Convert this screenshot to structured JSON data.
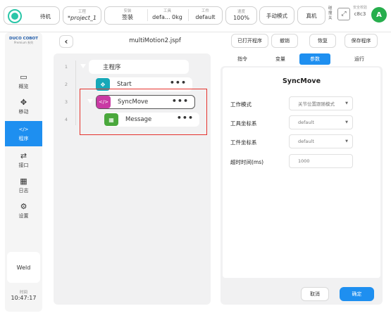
{
  "topbar": {
    "mode_label": "待机",
    "project": {
      "label": "工程",
      "value": "*project_1"
    },
    "install": {
      "label": "安装",
      "value": "签装"
    },
    "tool": {
      "label": "工具",
      "value": "defa... 0kg"
    },
    "workpiece": {
      "label": "工件",
      "value": "default"
    },
    "speed": {
      "label": "速度",
      "value": "100%"
    },
    "manual_mode": "手动模式",
    "real_machine": "真机",
    "collision": "碰撞关",
    "safety": {
      "label": "安全校验",
      "value": "c8c3"
    },
    "avatar": "A"
  },
  "sidebar": {
    "logo": "DUCO COBOT",
    "logo_sub": "Premium 系列",
    "items": [
      {
        "icon": "▭",
        "label": "概览"
      },
      {
        "icon": "✥",
        "label": "移动"
      },
      {
        "icon": "</>",
        "label": "程序"
      },
      {
        "icon": "⇄",
        "label": "接口"
      },
      {
        "icon": "▦",
        "label": "日志"
      },
      {
        "icon": "⚙",
        "label": "设置"
      }
    ],
    "weld": "Weld",
    "time_label": "时间",
    "time": "10:47:17"
  },
  "editor": {
    "back_icon": "‹",
    "filename": "multiMotion2.jspf",
    "tree": [
      {
        "line": "1",
        "label": "主程序"
      },
      {
        "line": "2",
        "label": "Start",
        "icon": "✥"
      },
      {
        "line": "3",
        "label": "SyncMove",
        "icon": "</>"
      },
      {
        "line": "4",
        "label": "Message",
        "icon": "▦"
      }
    ],
    "dots": "•••"
  },
  "toolbar": {
    "opened": "已打开程序",
    "undo": "撤销",
    "redo": "恢复",
    "save": "保存程序"
  },
  "tabs": [
    "指令",
    "变量",
    "参数",
    "运行"
  ],
  "params": {
    "title": "SyncMove",
    "fields": [
      {
        "label": "工作模式",
        "value": "关节位置跟随模式"
      },
      {
        "label": "工具坐标系",
        "value": "default"
      },
      {
        "label": "工件坐标系",
        "value": "default"
      },
      {
        "label": "超时时间(ms)",
        "value": "1000"
      }
    ],
    "cancel": "取消",
    "confirm": "确定"
  },
  "colors": {
    "accent": "#1e8ff0",
    "green": "#2bc6a8",
    "magenta": "#c93aa4",
    "highlight": "#e5322d"
  }
}
